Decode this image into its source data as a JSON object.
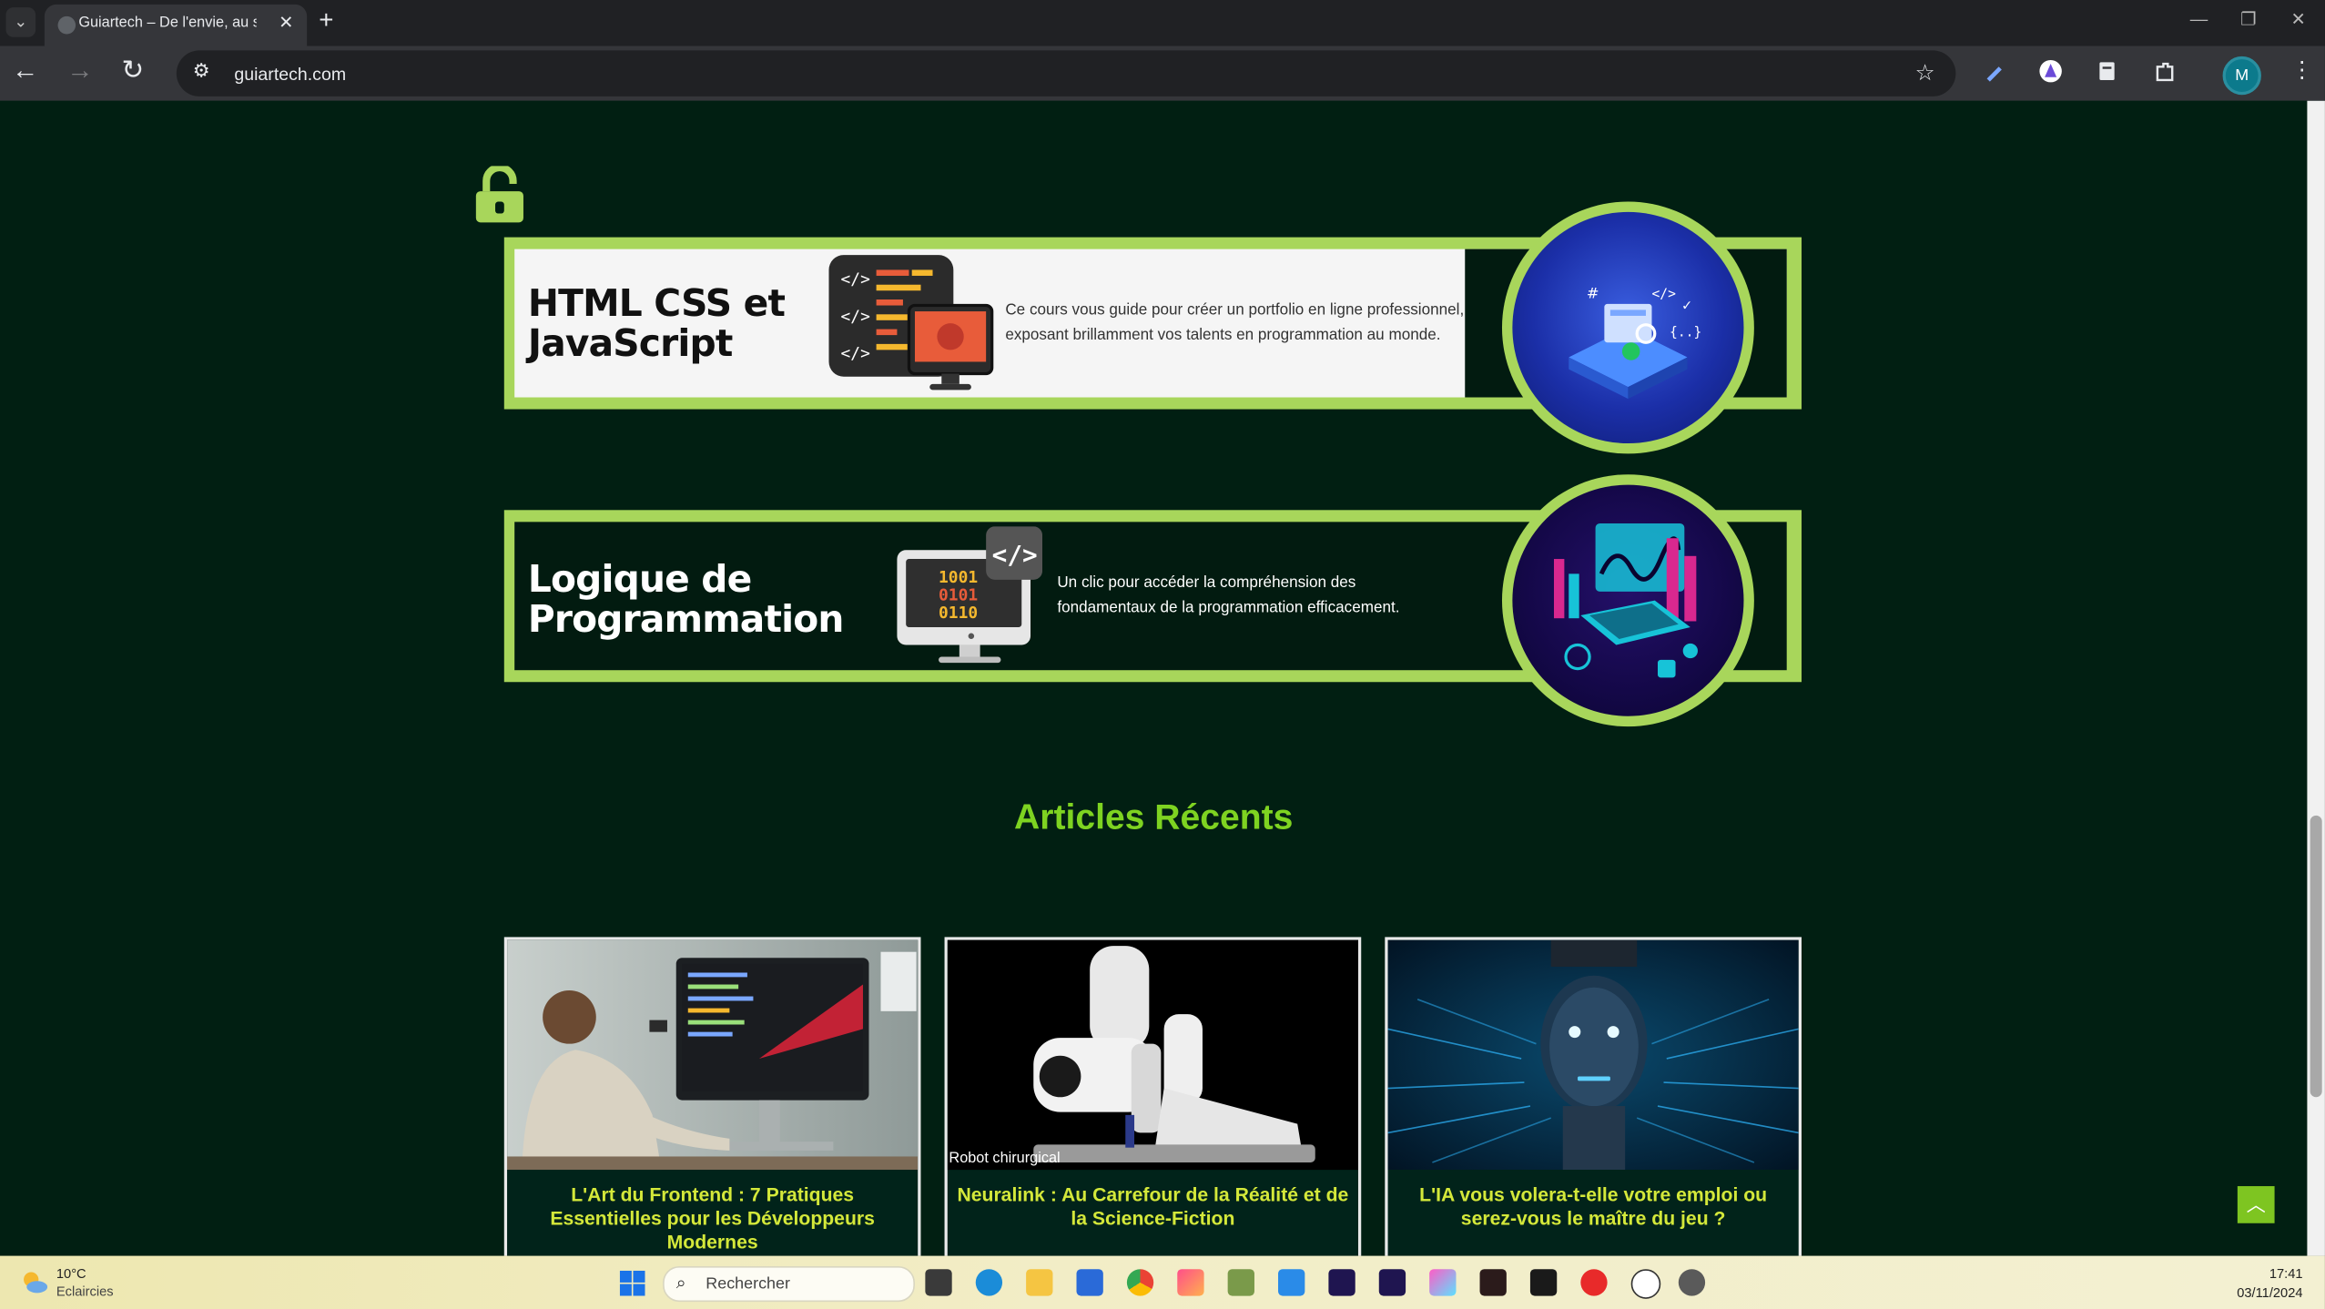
{
  "browser": {
    "tab_title": "Guiartech – De l'envie, au sa",
    "url": "guiartech.com",
    "profile_initial": "M"
  },
  "banners": [
    {
      "title_line1": "HTML CSS et",
      "title_line2": "JavaScript",
      "description_line1": "Ce cours vous guide pour créer un portfolio en ligne professionnel,",
      "description_line2": "exposant brillamment vos talents en programmation au monde.",
      "theme": "light"
    },
    {
      "title_line1": "Logique de",
      "title_line2": "Programmation",
      "description_line1": "Un clic pour accéder la compréhension des",
      "description_line2": "fondamentaux de la programmation efficacement.",
      "theme": "dark"
    }
  ],
  "section": {
    "title": "Articles Récents"
  },
  "articles": [
    {
      "title": "L'Art du Frontend : 7 Pratiques Essentielles pour les Développeurs Modernes",
      "image_caption": ""
    },
    {
      "title": "Neuralink : Au Carrefour de la Réalité et de la Science-Fiction",
      "image_caption": "Robot chirurgical"
    },
    {
      "title": "L'IA vous volera-t-elle votre emploi ou serez-vous le maître du jeu ?",
      "image_caption": ""
    }
  ],
  "taskbar": {
    "temperature": "10°C",
    "condition": "Eclaircies",
    "search_placeholder": "Rechercher",
    "time": "17:41",
    "date": "03/11/2024"
  },
  "colors": {
    "page_bg": "#011f12",
    "accent_green": "#a8d65b",
    "title_green": "#7ed321",
    "article_title": "#d4e83a"
  },
  "icons": [
    "lock-open-icon",
    "back-icon",
    "forward-icon",
    "reload-icon",
    "star-icon",
    "back-to-top-icon",
    "windows-icon",
    "search-icon"
  ]
}
